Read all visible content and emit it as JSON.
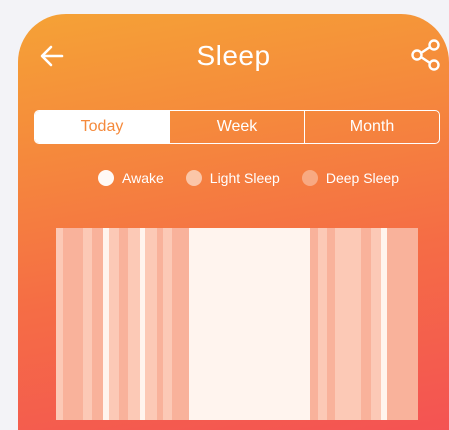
{
  "header": {
    "title": "Sleep",
    "back_icon": "arrow-left-icon",
    "share_icon": "share-icon"
  },
  "tabs": [
    {
      "label": "Today",
      "active": true
    },
    {
      "label": "Week",
      "active": false
    },
    {
      "label": "Month",
      "active": false
    }
  ],
  "legend": [
    {
      "label": "Awake",
      "state": "awake"
    },
    {
      "label": "Light Sleep",
      "state": "light"
    },
    {
      "label": "Deep Sleep",
      "state": "deep"
    }
  ],
  "colors": {
    "accent": "#f58a3c",
    "awake": "#fff4ee",
    "light": "#fcc9b6",
    "deep": "#f9b29b"
  },
  "sleep_timeline": [
    {
      "state": "light",
      "weight": 6
    },
    {
      "state": "deep",
      "weight": 17
    },
    {
      "state": "light",
      "weight": 7
    },
    {
      "state": "deep",
      "weight": 10
    },
    {
      "state": "awake",
      "weight": 5
    },
    {
      "state": "light",
      "weight": 8
    },
    {
      "state": "deep",
      "weight": 8
    },
    {
      "state": "light",
      "weight": 10
    },
    {
      "state": "awake",
      "weight": 4
    },
    {
      "state": "light",
      "weight": 10
    },
    {
      "state": "deep",
      "weight": 5
    },
    {
      "state": "light",
      "weight": 8
    },
    {
      "state": "deep",
      "weight": 14
    },
    {
      "state": "awake",
      "weight": 102
    },
    {
      "state": "deep",
      "weight": 7
    },
    {
      "state": "light",
      "weight": 7
    },
    {
      "state": "deep",
      "weight": 7
    },
    {
      "state": "light",
      "weight": 22
    },
    {
      "state": "deep",
      "weight": 8
    },
    {
      "state": "light",
      "weight": 9
    },
    {
      "state": "awake",
      "weight": 5
    },
    {
      "state": "deep",
      "weight": 26
    }
  ]
}
